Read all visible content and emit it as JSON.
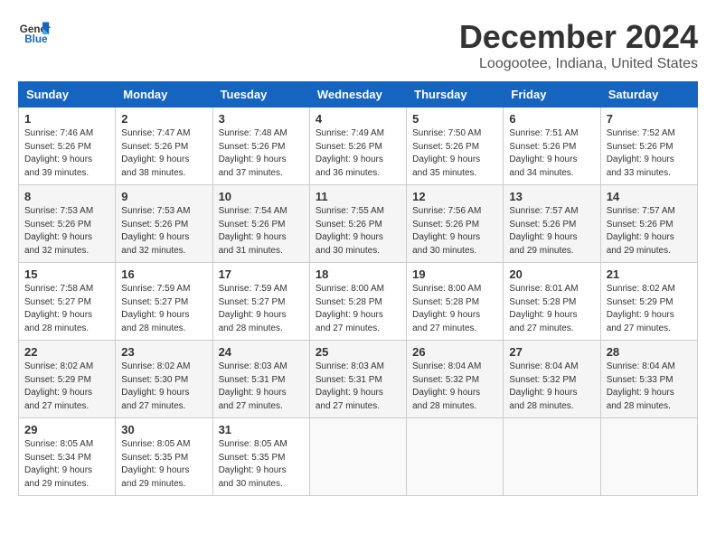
{
  "logo": {
    "line1": "General",
    "line2": "Blue"
  },
  "title": "December 2024",
  "location": "Loogootee, Indiana, United States",
  "days_of_week": [
    "Sunday",
    "Monday",
    "Tuesday",
    "Wednesday",
    "Thursday",
    "Friday",
    "Saturday"
  ],
  "weeks": [
    [
      {
        "day": 1,
        "info": "Sunrise: 7:46 AM\nSunset: 5:26 PM\nDaylight: 9 hours\nand 39 minutes."
      },
      {
        "day": 2,
        "info": "Sunrise: 7:47 AM\nSunset: 5:26 PM\nDaylight: 9 hours\nand 38 minutes."
      },
      {
        "day": 3,
        "info": "Sunrise: 7:48 AM\nSunset: 5:26 PM\nDaylight: 9 hours\nand 37 minutes."
      },
      {
        "day": 4,
        "info": "Sunrise: 7:49 AM\nSunset: 5:26 PM\nDaylight: 9 hours\nand 36 minutes."
      },
      {
        "day": 5,
        "info": "Sunrise: 7:50 AM\nSunset: 5:26 PM\nDaylight: 9 hours\nand 35 minutes."
      },
      {
        "day": 6,
        "info": "Sunrise: 7:51 AM\nSunset: 5:26 PM\nDaylight: 9 hours\nand 34 minutes."
      },
      {
        "day": 7,
        "info": "Sunrise: 7:52 AM\nSunset: 5:26 PM\nDaylight: 9 hours\nand 33 minutes."
      }
    ],
    [
      {
        "day": 8,
        "info": "Sunrise: 7:53 AM\nSunset: 5:26 PM\nDaylight: 9 hours\nand 32 minutes."
      },
      {
        "day": 9,
        "info": "Sunrise: 7:53 AM\nSunset: 5:26 PM\nDaylight: 9 hours\nand 32 minutes."
      },
      {
        "day": 10,
        "info": "Sunrise: 7:54 AM\nSunset: 5:26 PM\nDaylight: 9 hours\nand 31 minutes."
      },
      {
        "day": 11,
        "info": "Sunrise: 7:55 AM\nSunset: 5:26 PM\nDaylight: 9 hours\nand 30 minutes."
      },
      {
        "day": 12,
        "info": "Sunrise: 7:56 AM\nSunset: 5:26 PM\nDaylight: 9 hours\nand 30 minutes."
      },
      {
        "day": 13,
        "info": "Sunrise: 7:57 AM\nSunset: 5:26 PM\nDaylight: 9 hours\nand 29 minutes."
      },
      {
        "day": 14,
        "info": "Sunrise: 7:57 AM\nSunset: 5:26 PM\nDaylight: 9 hours\nand 29 minutes."
      }
    ],
    [
      {
        "day": 15,
        "info": "Sunrise: 7:58 AM\nSunset: 5:27 PM\nDaylight: 9 hours\nand 28 minutes."
      },
      {
        "day": 16,
        "info": "Sunrise: 7:59 AM\nSunset: 5:27 PM\nDaylight: 9 hours\nand 28 minutes."
      },
      {
        "day": 17,
        "info": "Sunrise: 7:59 AM\nSunset: 5:27 PM\nDaylight: 9 hours\nand 28 minutes."
      },
      {
        "day": 18,
        "info": "Sunrise: 8:00 AM\nSunset: 5:28 PM\nDaylight: 9 hours\nand 27 minutes."
      },
      {
        "day": 19,
        "info": "Sunrise: 8:00 AM\nSunset: 5:28 PM\nDaylight: 9 hours\nand 27 minutes."
      },
      {
        "day": 20,
        "info": "Sunrise: 8:01 AM\nSunset: 5:28 PM\nDaylight: 9 hours\nand 27 minutes."
      },
      {
        "day": 21,
        "info": "Sunrise: 8:02 AM\nSunset: 5:29 PM\nDaylight: 9 hours\nand 27 minutes."
      }
    ],
    [
      {
        "day": 22,
        "info": "Sunrise: 8:02 AM\nSunset: 5:29 PM\nDaylight: 9 hours\nand 27 minutes."
      },
      {
        "day": 23,
        "info": "Sunrise: 8:02 AM\nSunset: 5:30 PM\nDaylight: 9 hours\nand 27 minutes."
      },
      {
        "day": 24,
        "info": "Sunrise: 8:03 AM\nSunset: 5:31 PM\nDaylight: 9 hours\nand 27 minutes."
      },
      {
        "day": 25,
        "info": "Sunrise: 8:03 AM\nSunset: 5:31 PM\nDaylight: 9 hours\nand 27 minutes."
      },
      {
        "day": 26,
        "info": "Sunrise: 8:04 AM\nSunset: 5:32 PM\nDaylight: 9 hours\nand 28 minutes."
      },
      {
        "day": 27,
        "info": "Sunrise: 8:04 AM\nSunset: 5:32 PM\nDaylight: 9 hours\nand 28 minutes."
      },
      {
        "day": 28,
        "info": "Sunrise: 8:04 AM\nSunset: 5:33 PM\nDaylight: 9 hours\nand 28 minutes."
      }
    ],
    [
      {
        "day": 29,
        "info": "Sunrise: 8:05 AM\nSunset: 5:34 PM\nDaylight: 9 hours\nand 29 minutes."
      },
      {
        "day": 30,
        "info": "Sunrise: 8:05 AM\nSunset: 5:35 PM\nDaylight: 9 hours\nand 29 minutes."
      },
      {
        "day": 31,
        "info": "Sunrise: 8:05 AM\nSunset: 5:35 PM\nDaylight: 9 hours\nand 30 minutes."
      },
      null,
      null,
      null,
      null
    ]
  ]
}
